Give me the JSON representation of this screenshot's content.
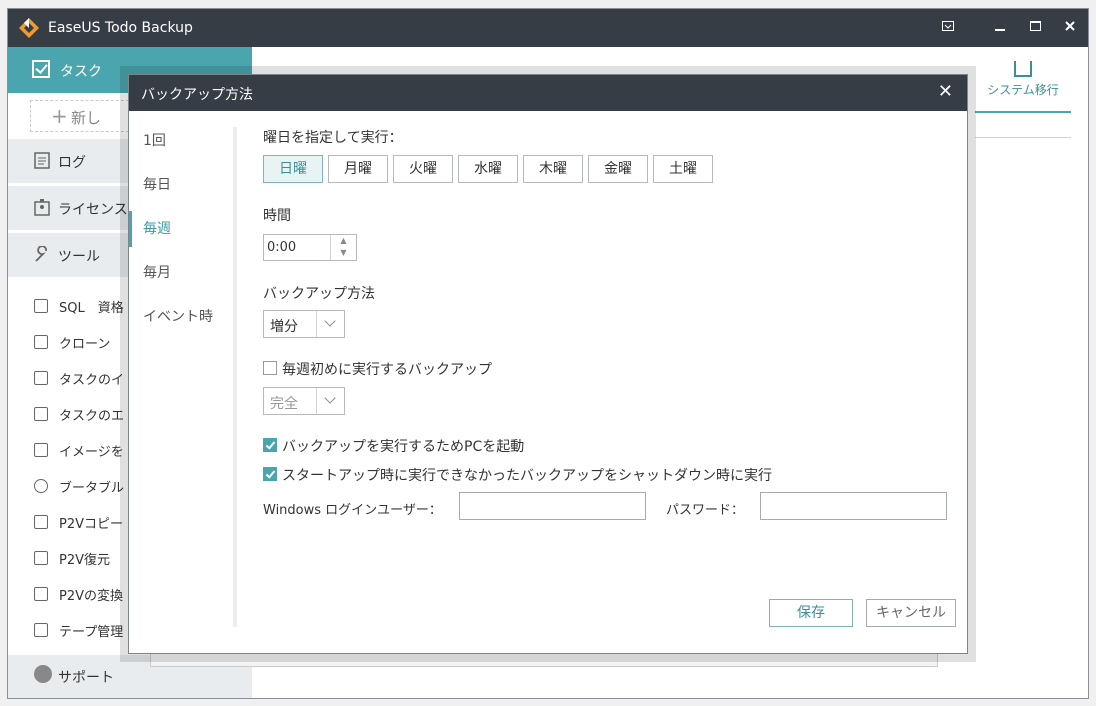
{
  "app": {
    "title": "EaseUS Todo Backup"
  },
  "sidebar": {
    "task_label": "タスク",
    "new_label": "新し",
    "log_label": "ログ",
    "license_label": "ライセンス",
    "tools_label": "ツール",
    "tools": [
      "SQL　資格",
      "クローン",
      "タスクのイ",
      "タスクのエ",
      "イメージを",
      "ブータブル",
      "P2Vコピー",
      "P2V復元",
      "P2Vの変換",
      "テープ管理"
    ],
    "support_label": "サポート"
  },
  "main": {
    "system_tab_label": "システム移行"
  },
  "dialog": {
    "title": "バックアップ方法",
    "frequency": [
      "1回",
      "毎日",
      "毎週",
      "毎月",
      "イベント時"
    ],
    "active_frequency": "毎週",
    "days_label": "曜日を指定して実行：",
    "days": [
      "日曜",
      "月曜",
      "火曜",
      "水曜",
      "木曜",
      "金曜",
      "土曜"
    ],
    "selected_day": "日曜",
    "time_label": "時間",
    "time_value": "0:00",
    "method_label": "バックアップ方法",
    "method_value": "増分",
    "weekly_first_label": "毎週初めに実行するバックアップ",
    "weekly_first_checked": false,
    "weekly_first_value": "完全",
    "wake_pc_label": "バックアップを実行するためPCを起動",
    "wake_pc_checked": true,
    "missed_label": "スタートアップ時に実行できなかったバックアップをシャットダウン時に実行",
    "missed_checked": true,
    "windows_user_label": "Windows ログインユーザー：",
    "password_label": "パスワード：",
    "windows_user_value": "",
    "password_value": "",
    "save_label": "保存",
    "cancel_label": "キャンセル"
  },
  "colors": {
    "accent": "#4aa5ae",
    "titlebar": "#373d45"
  }
}
